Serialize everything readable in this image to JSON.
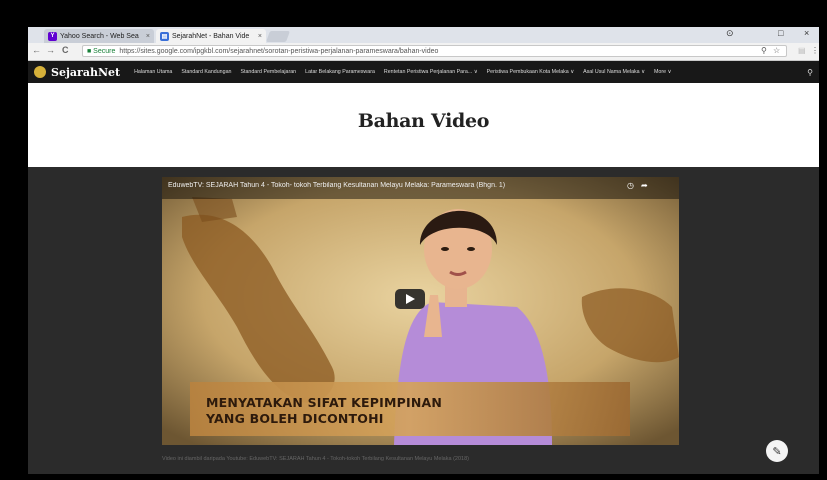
{
  "browser": {
    "tabs": [
      {
        "label": "Yahoo Search - Web Sea",
        "close": "×"
      },
      {
        "label": "SejarahNet - Bahan Vide",
        "close": "×"
      }
    ],
    "window_controls": {
      "minimize": "–",
      "maximize": "□",
      "close": "×"
    },
    "nav": {
      "back": "←",
      "forward": "→",
      "reload": "C"
    },
    "address": {
      "secure_label": "■ Secure",
      "url": "https://sites.google.com/ipgkbl.com/sejarahnet/sorotan-peristiwa-perjalanan-parameswara/bahan-video"
    },
    "icons": {
      "zoom": "🔍",
      "star": "☆",
      "menu": "⋮"
    }
  },
  "site": {
    "logo": "SejarahNet",
    "nav_links": [
      "Halaman Utama",
      "Standard Kandungan",
      "Standard Pembelajaran",
      "Latar Belakang Parameswara",
      "Rentetan Peristiwa Perjalanan Para... ∨",
      "Peristiwa Pembukaan Kota Melaka ∨",
      "Asal Usul Nama Melaka ∨",
      "More ∨"
    ],
    "search_icon": "⚲"
  },
  "page": {
    "title": "Bahan Video"
  },
  "video": {
    "title": "EduwebTV: SEJARAH Tahun 4 - Tokoh- tokoh Terbilang Kesultanan Melayu Melaka: Parameswara (Bhgn. 1)",
    "banner_line1": "MENYATAKAN SIFAT KEPIMPINAN",
    "banner_line2": "YANG BOLEH DICONTOHI"
  },
  "below_caption": "Video ini diambil daripada Youtube: EduwebTV: SEJARAH Tahun 4 - Tokoh-tokoh Terbilang Kesultanan Melayu Melaka (2018)",
  "edit_button_icon": "✎"
}
